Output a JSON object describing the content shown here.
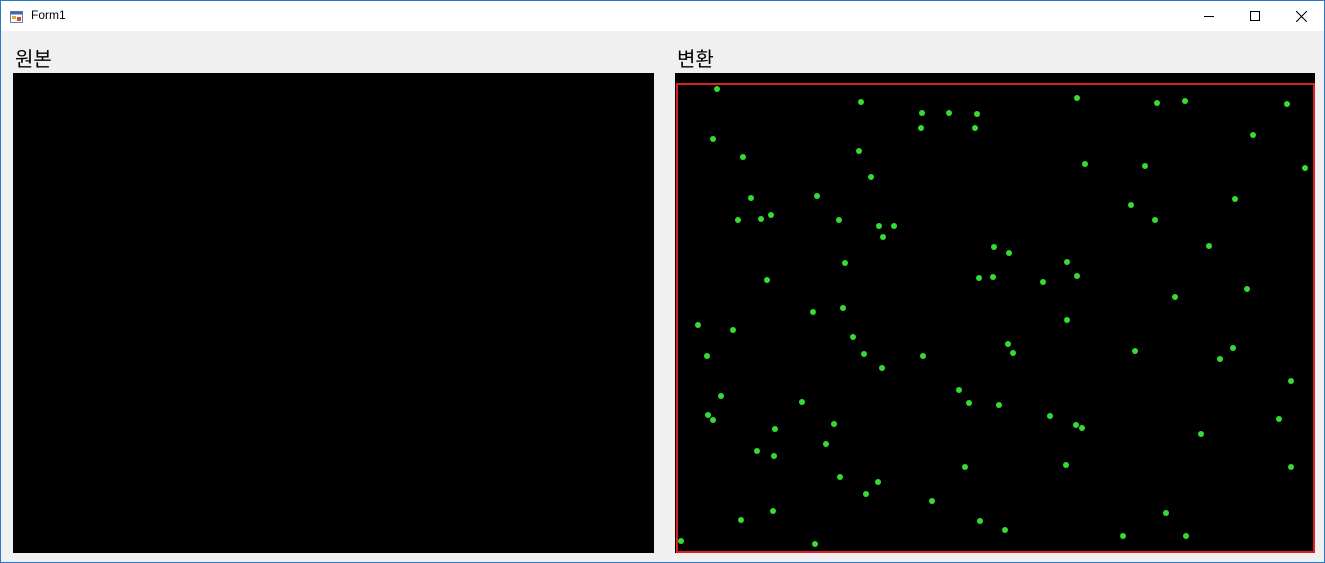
{
  "window": {
    "title": "Form1",
    "icon": "winforms-app-icon",
    "controls": {
      "minimize": "minimize-icon",
      "maximize": "maximize-icon",
      "close": "close-icon"
    }
  },
  "panels": {
    "original": {
      "label": "원본"
    },
    "converted": {
      "label": "변환"
    }
  },
  "colors": {
    "window_bg": "#f0f0f0",
    "image_bg": "#000000",
    "dot": "#33dd33",
    "frame": "#e02020"
  }
}
